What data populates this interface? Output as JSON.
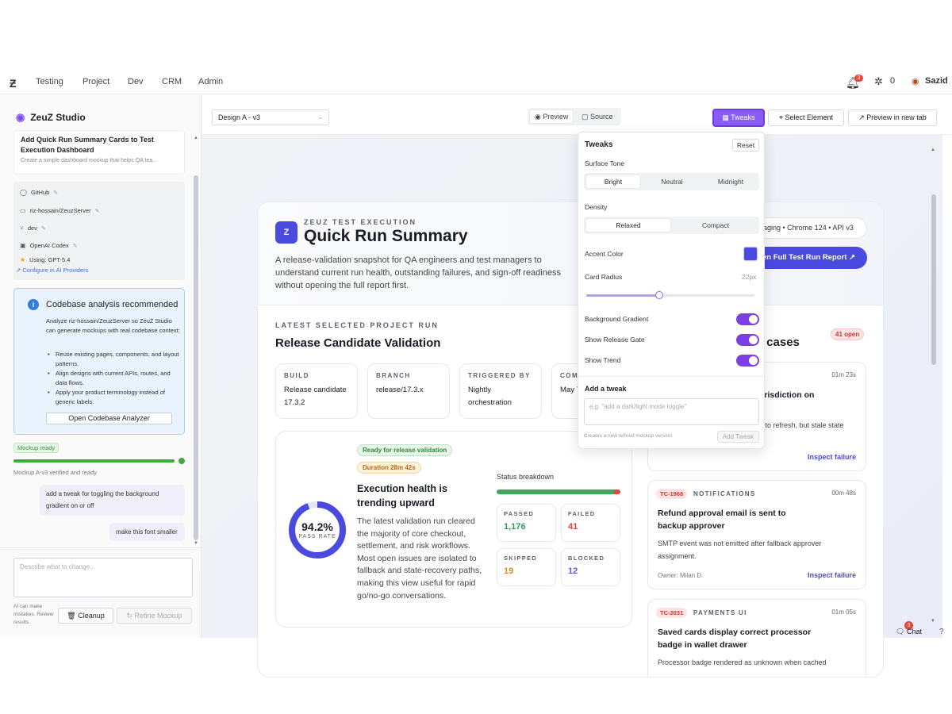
{
  "nav": {
    "links": [
      "Testing",
      "Project",
      "Dev",
      "CRM",
      "Admin"
    ],
    "notif_count": "3",
    "network_count": "0",
    "user": "Sazid"
  },
  "sidebar": {
    "brand": "ZeuZ Studio",
    "task_title": "Add Quick Run Summary Cards to Test Execution Dashboard",
    "task_sub": "Create a simple dashboard mockup that helps QA tea...",
    "context": {
      "github": "GitHub",
      "repo": "riz-hossain/ZeuzServer",
      "branch": "dev",
      "provider": "OpenAI Codex",
      "model": "Using: GPT-5.4",
      "configure": "Configure in AI Providers"
    },
    "analysis": {
      "title": "Codebase analysis recommended",
      "body": "Analyze riz-hossain/ZeuzServer so ZeuZ Studio can generate mockups with real codebase context:",
      "items": [
        "Reuse existing pages, components, and layout patterns.",
        "Align designs with current APIs, routes, and data flows.",
        "Apply your product terminology instead of generic labels."
      ],
      "button": "Open Codebase Analyzer"
    },
    "ready_badge": "Mockup ready",
    "ready_progress": 1.0,
    "verified": "Mockup A-v3 verified and ready",
    "messages": [
      "add a tweak for toggling the background gradient on or off",
      "make this font smaller"
    ],
    "input_placeholder": "Describe what to change...",
    "ai_note": "AI can make mistakes. Review results.",
    "cleanup": "Cleanup",
    "refine": "Refine Mockup"
  },
  "toolbar": {
    "design": "Design A - v3",
    "preview": "Preview",
    "source": "Source",
    "tweaks": "Tweaks",
    "select_element": "Select Element",
    "preview_new_tab": "Preview in new tab"
  },
  "preview": {
    "badge": "Z",
    "eyebrow": "ZEUZ TEST EXECUTION",
    "title": "Quick Run Summary",
    "desc": "A release-validation snapshot for QA engineers and test managers to understand current run health, outstanding failures, and sign-off readiness without opening the full report first.",
    "env": "aging • Chrome 124 • API v3",
    "report_btn": "en Full Test Run Report",
    "section_eyebrow": "LATEST SELECTED PROJECT RUN",
    "section_title": "Release Candidate Validation",
    "info": [
      {
        "label": "BUILD",
        "value": "Release candidate 17.3.2"
      },
      {
        "label": "BRANCH",
        "value": "release/17.3.x"
      },
      {
        "label": "TRIGGERED BY",
        "value": "Nightly orchestration"
      },
      {
        "label": "COM",
        "value": "May 7 09:14"
      }
    ],
    "health": {
      "tag_ready": "Ready for release validation",
      "tag_duration": "Duration 28m 42s",
      "pass_rate": "94.2%",
      "pass_rate_value": 0.942,
      "pass_label": "PASS RATE",
      "title": "Execution health is trending upward",
      "body": "The latest validation run cleared the majority of core checkout, settlement, and risk workflows. Most open issues are isolated to fallback and state-recovery paths, making this view useful for rapid go/no-go conversations.",
      "breakdown_title": "Status breakdown",
      "stats": [
        {
          "label": "PASSED",
          "value": "1,176",
          "color": "#2f9a5f"
        },
        {
          "label": "FAILED",
          "value": "41",
          "color": "#d9453a"
        },
        {
          "label": "SKIPPED",
          "value": "19",
          "color": "#d98a1a"
        },
        {
          "label": "BLOCKED",
          "value": "12",
          "color": "#5a59d6"
        }
      ]
    },
    "failures": {
      "header": "t cases",
      "open": "41 open",
      "cards": [
        {
          "tag": "",
          "area": "",
          "time": "01m 23s",
          "title": "urisdiction on",
          "body": "e to refresh, but stale state",
          "owner": "",
          "link": "Inspect failure"
        },
        {
          "tag": "TC-1968",
          "area": "NOTIFICATIONS",
          "time": "00m 48s",
          "title": "Refund approval email is sent to backup approver",
          "body": "SMTP event was not emitted after fallback approver assignment.",
          "owner": "Owner: Milan D.",
          "link": "Inspect failure"
        },
        {
          "tag": "TC-2031",
          "area": "PAYMENTS UI",
          "time": "01m 05s",
          "title": "Saved cards display correct processor badge in wallet drawer",
          "body": "Processor badge rendered as unknown when cached",
          "owner": "",
          "link": ""
        }
      ]
    }
  },
  "tweaks": {
    "title": "Tweaks",
    "reset": "Reset",
    "surface_label": "Surface Tone",
    "surface": [
      "Bright",
      "Neutral",
      "Midnight"
    ],
    "density_label": "Density",
    "density": [
      "Relaxed",
      "Compact"
    ],
    "accent_label": "Accent Color",
    "accent_color": "#4a49e0",
    "radius_label": "Card Radius",
    "radius_value": "22px",
    "toggles": [
      {
        "label": "Background Gradient",
        "on": true
      },
      {
        "label": "Show Release Gate",
        "on": true
      },
      {
        "label": "Show Trend",
        "on": true
      }
    ],
    "add_title": "Add a tweak",
    "add_placeholder": "e.g. \"add a dark/light mode toggle\"",
    "hint": "Creates a new refined mockup version.",
    "add_btn": "Add Tweak"
  },
  "chat": {
    "label": "Chat",
    "count": "3",
    "help": "?"
  }
}
